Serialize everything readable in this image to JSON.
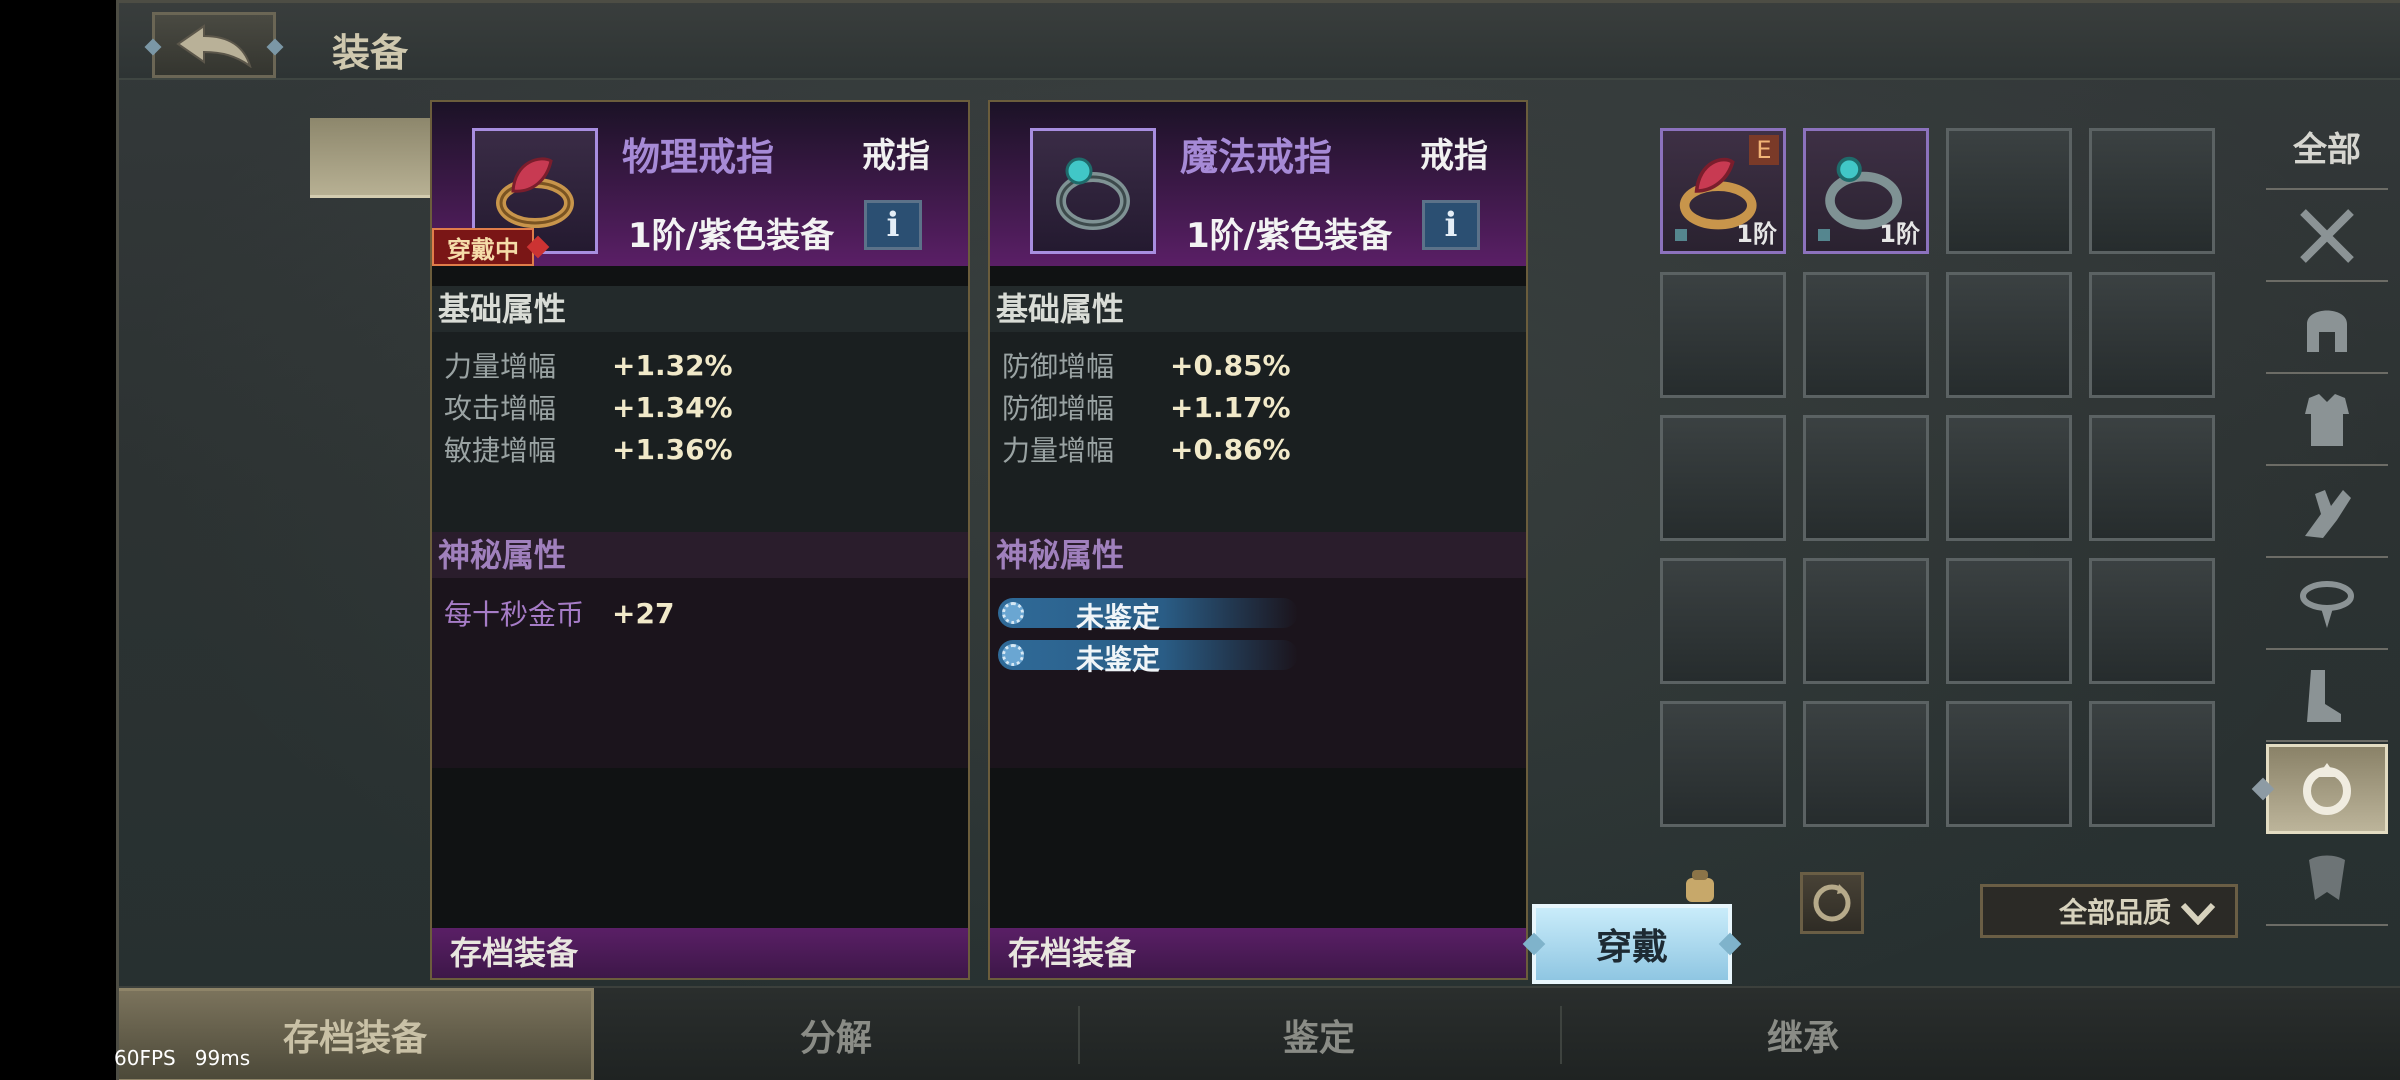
{
  "header": {
    "title": "装备"
  },
  "panels": [
    {
      "name": "物理戒指",
      "type": "戒指",
      "tier": "1阶/紫色装备",
      "info": "i",
      "equipped_badge": "穿戴中",
      "base_title": "基础属性",
      "base_stats": [
        {
          "label": "力量增幅",
          "value": "+1.32%"
        },
        {
          "label": "攻击增幅",
          "value": "+1.34%"
        },
        {
          "label": "敏捷增幅",
          "value": "+1.36%"
        }
      ],
      "mystic_title": "神秘属性",
      "mystic_stats": [
        {
          "label": "每十秒金币",
          "value": "+27"
        }
      ],
      "footer": "存档装备",
      "gem_color": "#c83a52"
    },
    {
      "name": "魔法戒指",
      "type": "戒指",
      "tier": "1阶/紫色装备",
      "info": "i",
      "base_title": "基础属性",
      "base_stats": [
        {
          "label": "防御增幅",
          "value": "+0.85%"
        },
        {
          "label": "防御增幅",
          "value": "+1.17%"
        },
        {
          "label": "力量增幅",
          "value": "+0.86%"
        }
      ],
      "mystic_title": "神秘属性",
      "mystic_unidentified": [
        "未鉴定",
        "未鉴定"
      ],
      "footer": "存档装备",
      "gem_color": "#41c7c7"
    }
  ],
  "inventory": {
    "slots": [
      {
        "tag": "E",
        "level": "1阶",
        "item": "red-ring-icon"
      },
      {
        "level": "1阶",
        "item": "teal-ring-icon"
      }
    ]
  },
  "categories": {
    "all": "全部",
    "icons": [
      "crossed-swords-icon",
      "helmet-icon",
      "armor-icon",
      "gauntlet-icon",
      "necklace-icon",
      "boots-icon",
      "ring-icon",
      "cape-icon"
    ]
  },
  "quality_filter": {
    "selected": "全部品质"
  },
  "wear_button": "穿戴",
  "tabs": [
    "存档装备",
    "分解",
    "鉴定",
    "继承"
  ],
  "fps": {
    "fps": "60FPS",
    "ms": "99ms"
  }
}
